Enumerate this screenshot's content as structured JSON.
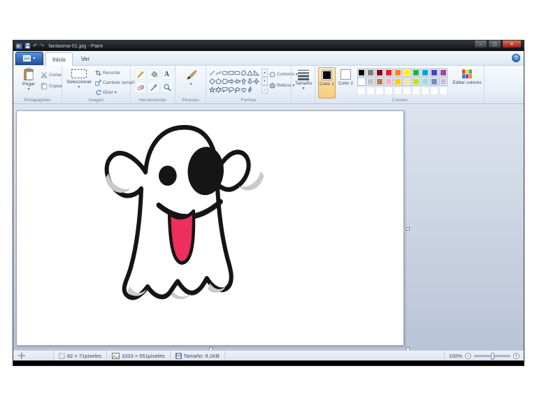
{
  "window": {
    "title": "fantasma-01.jpg - Paint",
    "minimize_glyph": "–",
    "maximize_glyph": "▢",
    "close_glyph": "✕",
    "help_glyph": "?"
  },
  "tabs": {
    "inicio": "Inicio",
    "ver": "Ver"
  },
  "ui": {
    "caret": "▾",
    "scroll_up": "▴",
    "scroll_down": "▾",
    "scroll_more": "⌄",
    "undo": "↶",
    "redo": "↷",
    "zoom_minus": "–",
    "zoom_plus": "+"
  },
  "ribbon": {
    "clipboard": {
      "group_label": "Portapapeles",
      "paste_label": "Pegar",
      "cut_label": "Cortar",
      "copy_label": "Copiar"
    },
    "image": {
      "group_label": "Imagen",
      "select_label": "Seleccionar",
      "crop_label": "Recortar",
      "resize_label": "Cambiar tamaño",
      "rotate_label": "Girar"
    },
    "tools": {
      "group_label": "Herramientas",
      "items": [
        "pencil",
        "fill",
        "text",
        "eraser",
        "color-picker",
        "magnifier"
      ]
    },
    "brushes": {
      "group_label": "Pinceles"
    },
    "shapes": {
      "group_label": "Formas",
      "outline_label": "Contorno",
      "fill_label": "Relleno",
      "items": [
        "line",
        "curve",
        "oval",
        "rectangle",
        "rounded-rectangle",
        "polygon",
        "triangle",
        "right-triangle",
        "diamond",
        "pentagon",
        "hexagon",
        "arrow-right",
        "arrow-left",
        "arrow-up",
        "arrow-down",
        "four-point-star",
        "five-point-star",
        "six-point-star",
        "rounded-callout",
        "oval-callout",
        "cloud-callout",
        "heart",
        "lightning",
        "blank"
      ]
    },
    "size": {
      "button_label": "Tamaño"
    },
    "colors": {
      "group_label": "Colores",
      "color1_label": "Color 1",
      "color2_label": "Color 2",
      "edit_label": "Editar colores",
      "color1_value": "#000000",
      "color2_value": "#ffffff",
      "palette_row1": [
        "#000000",
        "#7f7f7f",
        "#880015",
        "#ed1c24",
        "#ff7f27",
        "#fff200",
        "#22b14c",
        "#00a2e8",
        "#3f48cc",
        "#a349a4"
      ],
      "palette_row2": [
        "#ffffff",
        "#c3c3c3",
        "#b97a57",
        "#ffaec9",
        "#ffc90e",
        "#efe4b0",
        "#b5e61d",
        "#99d9ea",
        "#7092be",
        "#c8bfe7"
      ],
      "palette_row3": [
        "",
        "",
        "",
        "",
        "",
        "",
        "",
        "",
        "",
        ""
      ]
    }
  },
  "statusbar": {
    "selection_size": "82 × 71píxeles",
    "image_size": "1033 × 551píxeles",
    "file_size": "Tamaño: 9.1KB",
    "zoom_level": "100%"
  },
  "drawing": {
    "subject": "ghost",
    "tongue_color": "#ee2e5c",
    "shadow_color": "#c9c9c9",
    "outline_color": "#151515"
  }
}
